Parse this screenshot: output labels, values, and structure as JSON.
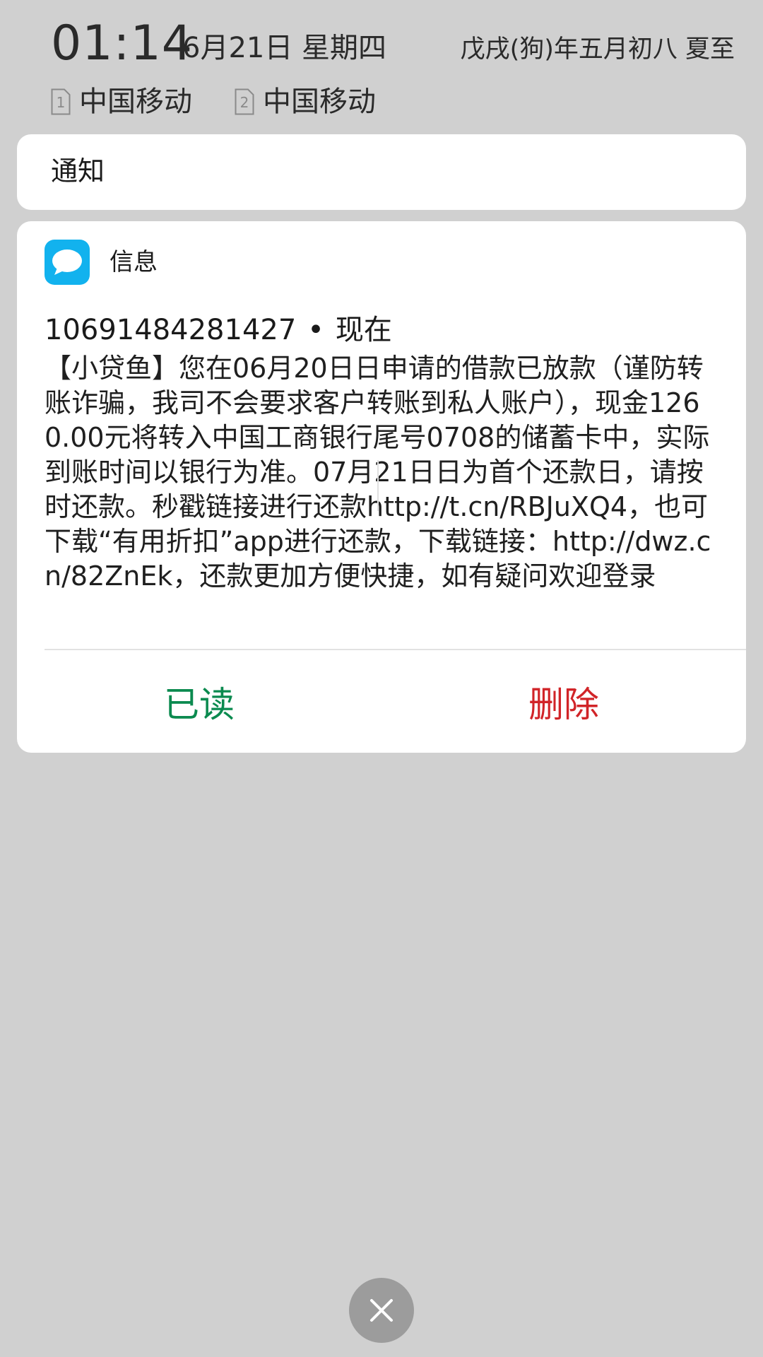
{
  "status": {
    "time": "01:14",
    "date": "6月21日 星期四",
    "lunar": "戊戌(狗)年五月初八 夏至"
  },
  "carriers": [
    {
      "sim": "1",
      "name": "中国移动"
    },
    {
      "sim": "2",
      "name": "中国移动"
    }
  ],
  "notification_header": {
    "title": "通知"
  },
  "message": {
    "app_icon": "message-bubble-icon",
    "app_name": "信息",
    "sender": "10691484281427",
    "separator": "•",
    "time_label": "现在",
    "body": "【小贷鱼】您在06月20日日申请的借款已放款（谨防转账诈骗，我司不会要求客户转账到私人账户），现金1260.00元将转入中国工商银行尾号0708的储蓄卡中，实际到账时间以银行为准。07月21日日为首个还款日，请按时还款。秒戳链接进行还款http://t.cn/RBJuXQ4，也可下载“有用折扣”app进行还款，下载链接：http://dwz.cn/82ZnEk，还款更加方便快捷，如有疑问欢迎登录"
  },
  "actions": {
    "read_label": "已读",
    "delete_label": "删除"
  },
  "close_button": {
    "icon": "close-icon"
  },
  "colors": {
    "background": "#d0d0d0",
    "card": "#ffffff",
    "app_icon": "#12b2ee",
    "read": "#0b8a4f",
    "delete": "#d12428",
    "close_button": "#9c9c9c"
  }
}
